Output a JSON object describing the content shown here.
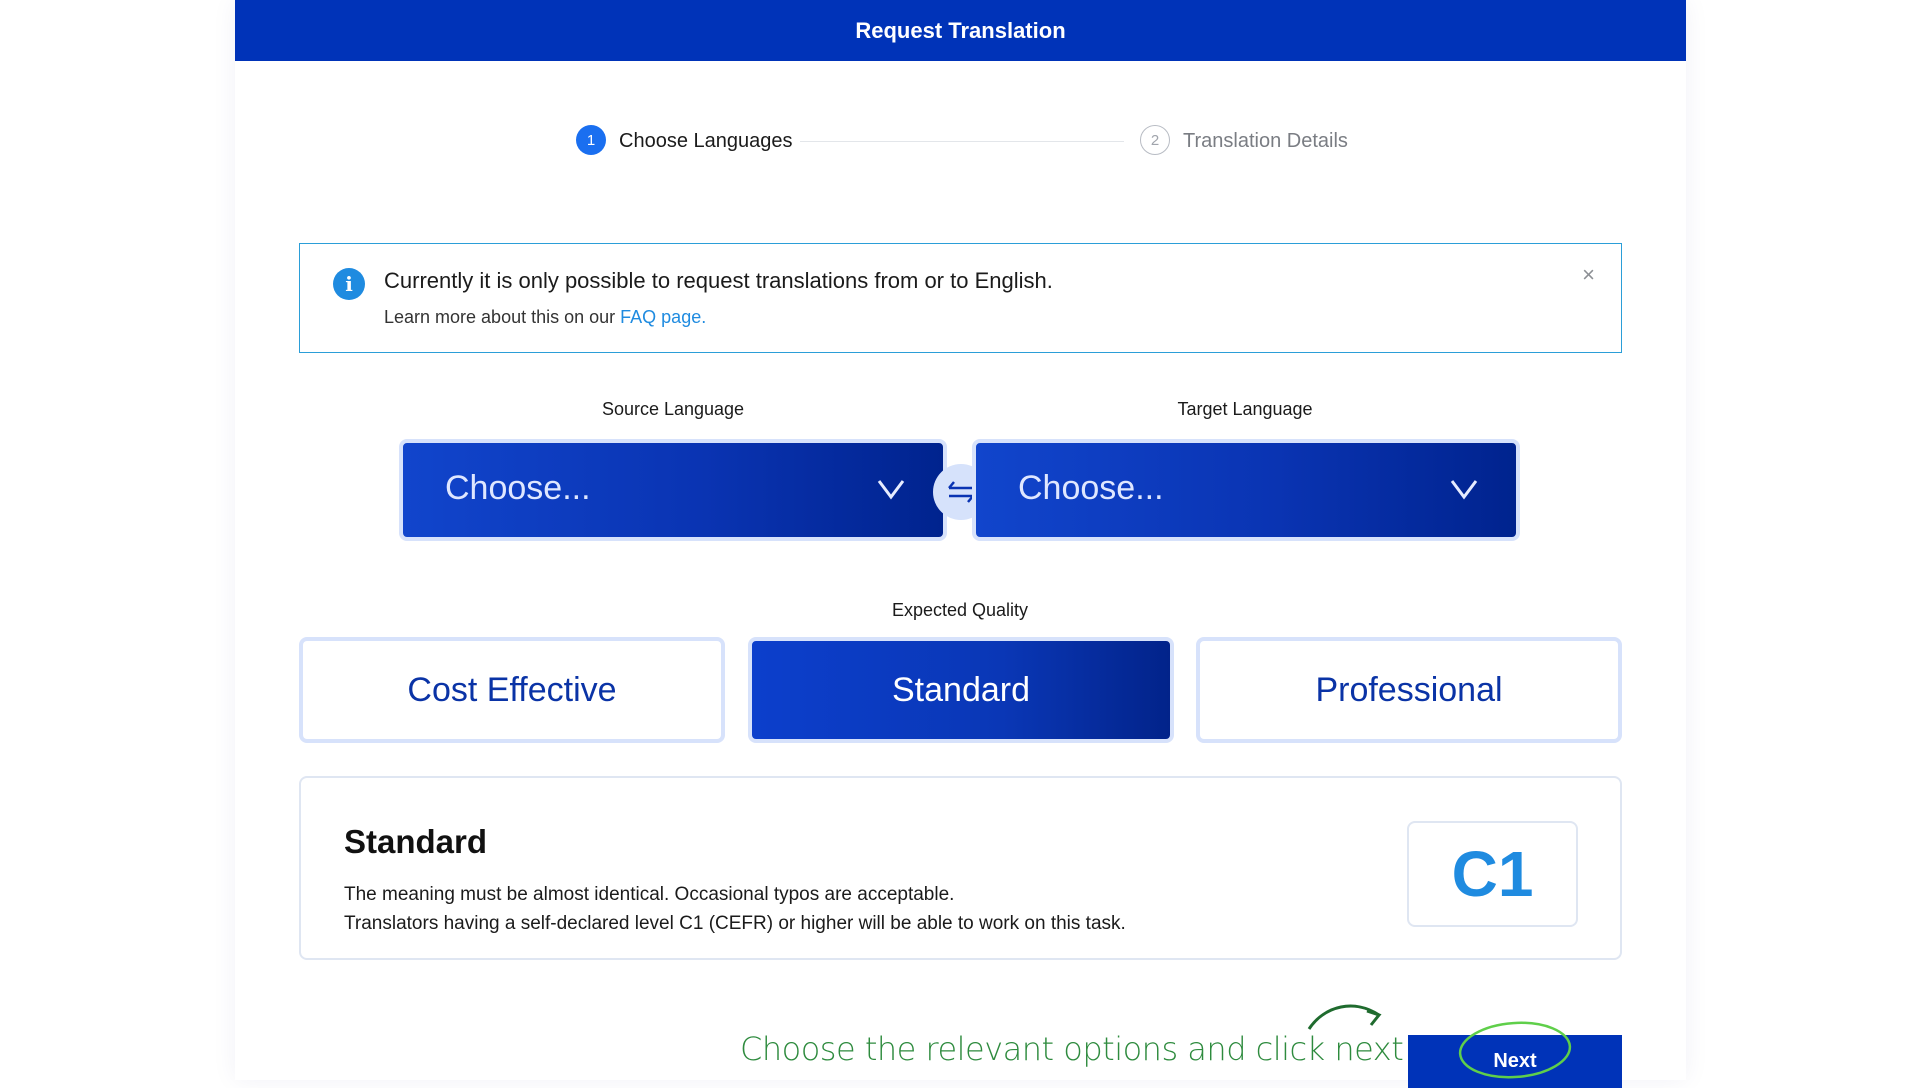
{
  "header": {
    "title": "Request Translation"
  },
  "stepper": {
    "steps": [
      {
        "number": "1",
        "label": "Choose Languages"
      },
      {
        "number": "2",
        "label": "Translation Details"
      }
    ]
  },
  "alert": {
    "message": "Currently it is only possible to request translations from or to English.",
    "sub_prefix": "Learn more about this on our ",
    "link_text": "FAQ page.",
    "close_glyph": "×"
  },
  "languages": {
    "source_label": "Source Language",
    "source_value": "Choose...",
    "target_label": "Target Language",
    "target_value": "Choose..."
  },
  "quality": {
    "label": "Expected Quality",
    "options": [
      "Cost Effective",
      "Standard",
      "Professional"
    ],
    "selected": "Standard"
  },
  "description": {
    "title": "Standard",
    "line1": "The meaning must be almost identical. Occasional typos are acceptable.",
    "line2": "Translators having a self-declared level C1 (CEFR) or higher will be able to work on this task.",
    "level": "C1"
  },
  "annotation": {
    "hint": "Choose the relevant options and click next"
  },
  "footer": {
    "next_label": "Next"
  },
  "colors": {
    "brand_blue": "#0033b8",
    "accent_blue": "#1f8be0",
    "annotation_green": "#2e8b3e"
  }
}
